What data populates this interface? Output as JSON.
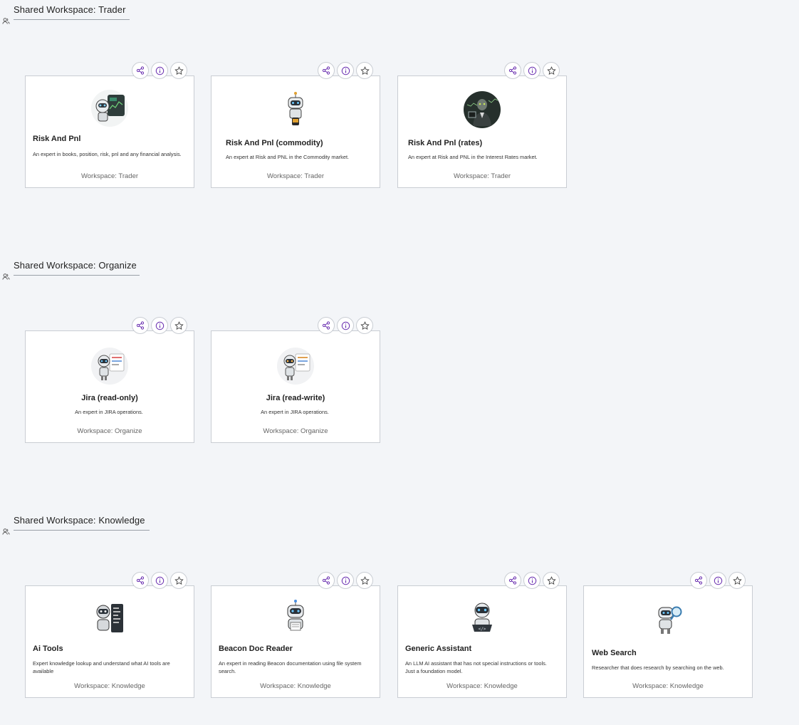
{
  "sections": [
    {
      "title": "Shared Workspace: Trader",
      "cards": [
        {
          "title": "Risk And Pnl",
          "description": "An expert in books, position, risk, pnl and any financial analysis.",
          "footer": "Workspace: Trader"
        },
        {
          "title": "Risk And Pnl (commodity)",
          "description": "An expert at Risk and PNL in the Commodity market.",
          "footer": "Workspace: Trader"
        },
        {
          "title": "Risk And Pnl (rates)",
          "description": "An expert at Risk and PNL in the Interest Rates market.",
          "footer": "Workspace: Trader"
        }
      ]
    },
    {
      "title": "Shared Workspace: Organize",
      "cards": [
        {
          "title": "Jira (read-only)",
          "description": "An expert in JIRA operations.",
          "footer": "Workspace: Organize"
        },
        {
          "title": "Jira (read-write)",
          "description": "An expert in JIRA operations.",
          "footer": "Workspace: Organize"
        }
      ]
    },
    {
      "title": "Shared Workspace: Knowledge",
      "cards": [
        {
          "title": "Ai Tools",
          "description": "Expert knowledge lookup and understand what AI tools are available",
          "footer": "Workspace: Knowledge"
        },
        {
          "title": "Beacon Doc Reader",
          "description": "An expert in reading Beacon documentation using file system search.",
          "footer": "Workspace: Knowledge"
        },
        {
          "title": "Generic Assistant",
          "description": "An LLM AI assistant that has not special instructions or tools. Just a foundation model.",
          "footer": "Workspace: Knowledge"
        },
        {
          "title": "Web Search",
          "description": "Researcher that does research by searching on the web.",
          "footer": "Workspace: Knowledge"
        }
      ]
    }
  ],
  "icons": {
    "section": "users-icon",
    "share": "share-icon",
    "info": "info-icon",
    "favorite": "star-icon",
    "avatar": "robot-avatar-icon"
  },
  "colors": {
    "accent": "#6a2fb0",
    "background": "#f3f5f8",
    "card_border": "#c9cdd3"
  }
}
